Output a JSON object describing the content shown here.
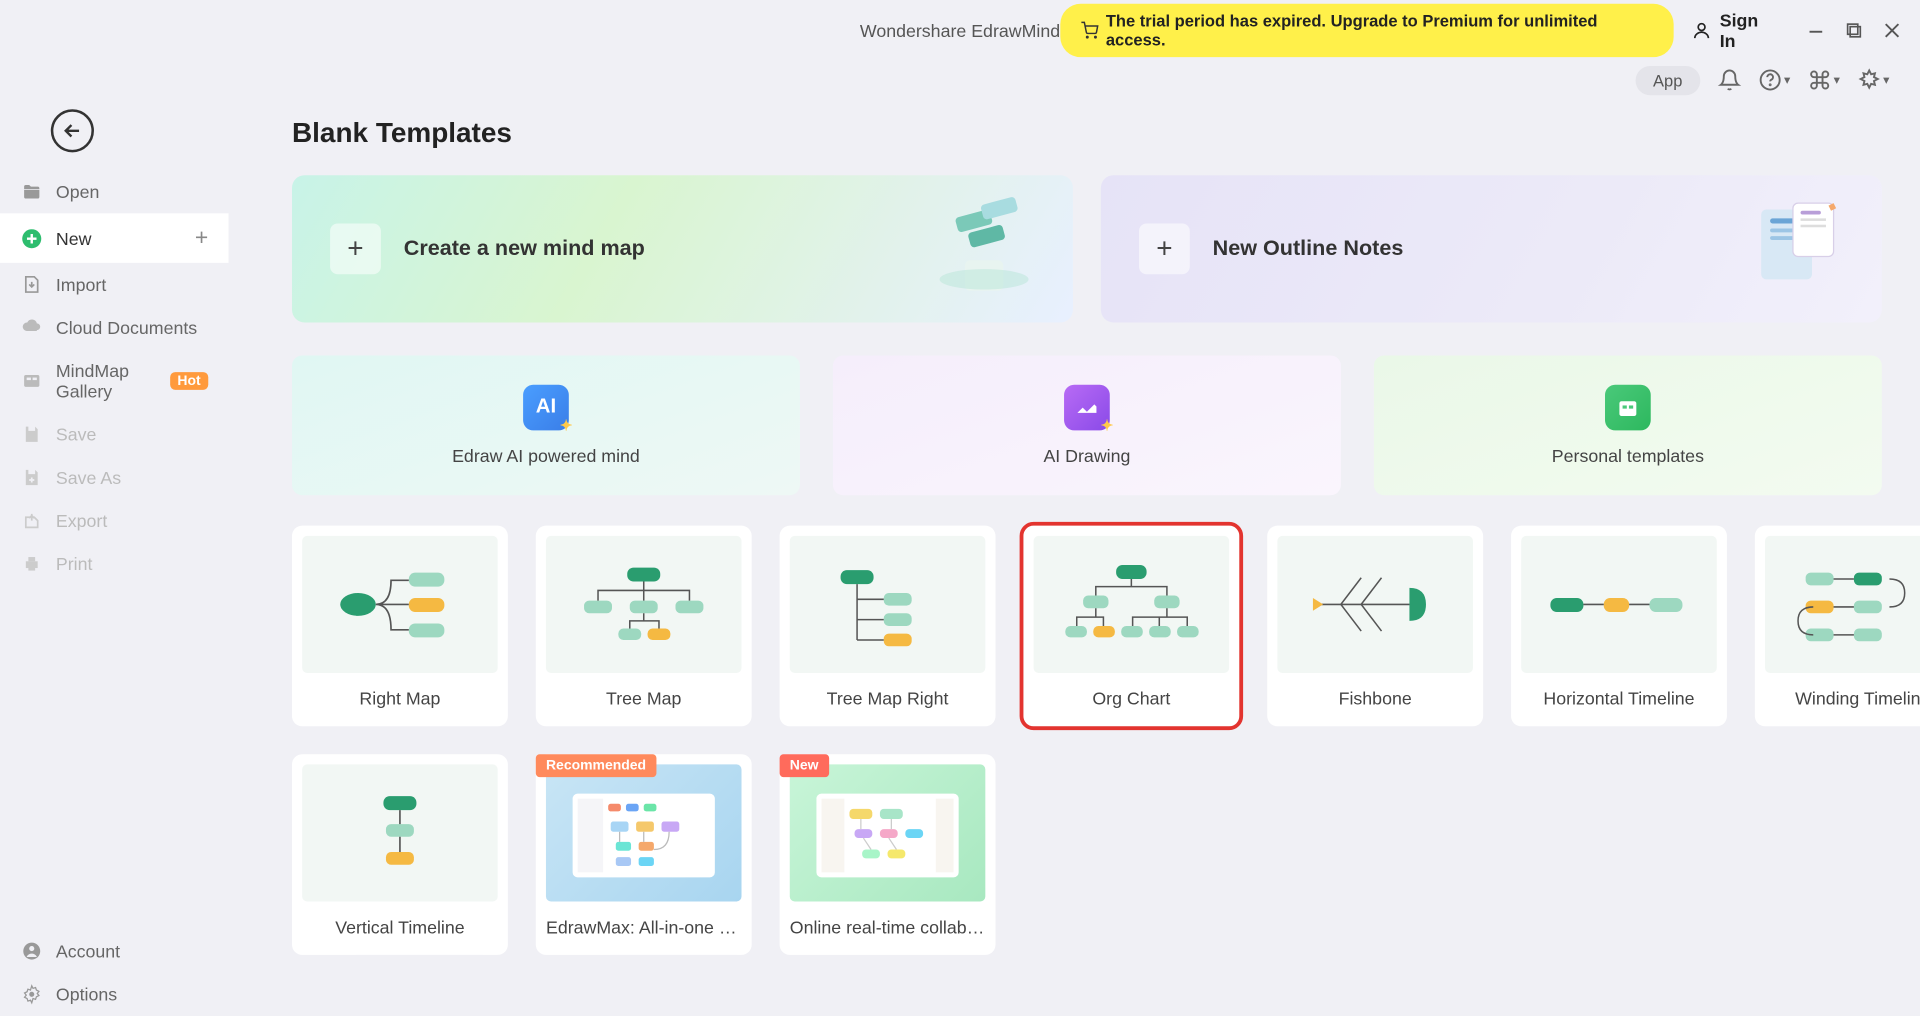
{
  "app": {
    "title": "Wondershare EdrawMind"
  },
  "banner": {
    "text": "The trial period has expired. Upgrade to Premium for unlimited access."
  },
  "auth": {
    "signin": "Sign In"
  },
  "toolbar2": {
    "app": "App"
  },
  "sidebar": {
    "open": "Open",
    "new": "New",
    "import": "Import",
    "cloud": "Cloud Documents",
    "gallery": "MindMap Gallery",
    "gallery_badge": "Hot",
    "save": "Save",
    "saveas": "Save As",
    "export": "Export",
    "print": "Print",
    "account": "Account",
    "options": "Options"
  },
  "page": {
    "title": "Blank Templates"
  },
  "hero": {
    "mindmap": "Create a new mind map",
    "outline": "New Outline Notes"
  },
  "promo": {
    "ai_mind": "Edraw AI powered mind",
    "ai_drawing": "AI Drawing",
    "personal": "Personal templates"
  },
  "templates": {
    "right_map": "Right Map",
    "tree_map": "Tree Map",
    "tree_map_right": "Tree Map Right",
    "org_chart": "Org Chart",
    "fishbone": "Fishbone",
    "horiz_timeline": "Horizontal Timeline",
    "winding_timeline": "Winding Timeline",
    "vert_timeline": "Vertical Timeline",
    "edrawmax": "EdrawMax: All-in-one Dia...",
    "online_collab": "Online real-time collabora...",
    "tag_recommended": "Recommended",
    "tag_new": "New"
  }
}
